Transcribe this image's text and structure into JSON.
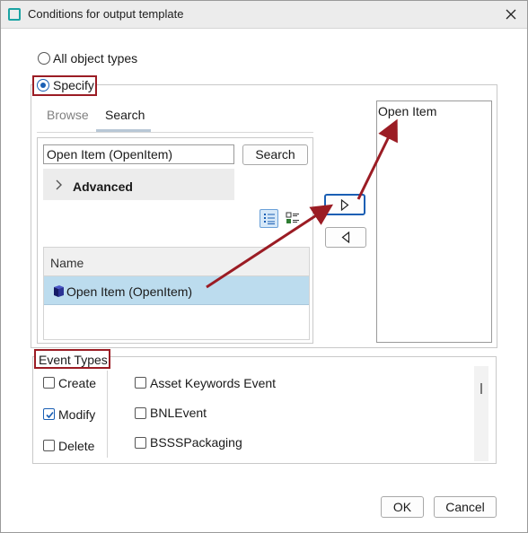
{
  "window": {
    "title": "Conditions for output template",
    "close_icon": "close-icon"
  },
  "object_types": {
    "all_label": "All object types",
    "specify_label": "Specify"
  },
  "tabs": [
    {
      "label": "Browse"
    },
    {
      "label": "Search"
    }
  ],
  "search": {
    "value": "Open Item (OpenItem)",
    "button_label": "Search",
    "advanced_label": "Advanced"
  },
  "view_icons": [
    "list-view-icon",
    "detail-view-icon"
  ],
  "results": {
    "column_header": "Name",
    "rows": [
      {
        "label": "Open Item (OpenItem)",
        "icon": "cube-icon"
      }
    ]
  },
  "transfer": {
    "add_icon": "arrow-right-icon",
    "remove_icon": "arrow-left-icon"
  },
  "selected": {
    "items": [
      "Open Item"
    ]
  },
  "event_types": {
    "heading": "Event Types",
    "basic": [
      {
        "label": "Create",
        "checked": false
      },
      {
        "label": "Modify",
        "checked": true
      },
      {
        "label": "Delete",
        "checked": false
      }
    ],
    "specific": [
      {
        "label": "Asset Keywords Event",
        "checked": false
      },
      {
        "label": "BNLEvent",
        "checked": false
      },
      {
        "label": "BSSSPackaging",
        "checked": false
      }
    ]
  },
  "footer": {
    "ok_label": "OK",
    "cancel_label": "Cancel"
  },
  "colors": {
    "accent": "#1a5fb4",
    "annotation": "#9b1c24",
    "selection": "#bcdcee"
  }
}
